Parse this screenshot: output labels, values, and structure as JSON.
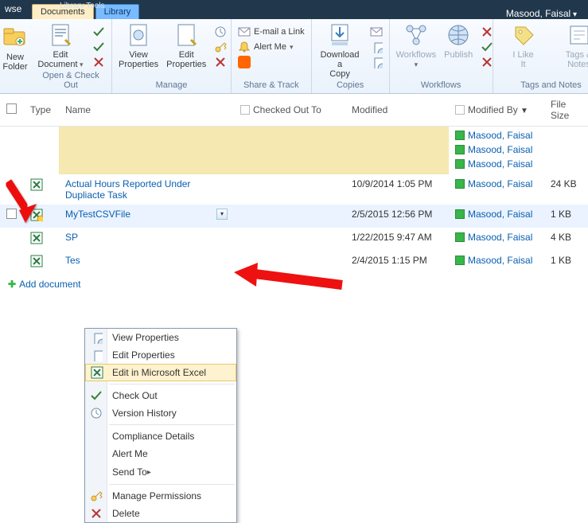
{
  "user": "Masood, Faisal",
  "tabset_label": "Library Tools",
  "tabs": {
    "browse_edge": "wse",
    "documents": "Documents",
    "library": "Library"
  },
  "ribbon": {
    "groups": {
      "open_checkout": {
        "title": "Open & Check Out",
        "new_folder": "New\nFolder",
        "edit_document": "Edit\nDocument",
        "check_out": "Check Out",
        "check_in": "Check In",
        "discard": "Discard Check Out"
      },
      "manage": {
        "title": "Manage",
        "view_properties": "View\nProperties",
        "edit_properties": "Edit\nProperties",
        "version": "Version History",
        "perms": "Document Permissions",
        "delete": "Delete Document"
      },
      "share_track": {
        "title": "Share & Track",
        "email": "E-mail a Link",
        "alert": "Alert Me",
        "rss": "RSS Feed"
      },
      "copies": {
        "title": "Copies",
        "download": "Download a\nCopy",
        "send_to": "Send To",
        "manage_copies": "Manage Copies",
        "source": "Go To Source"
      },
      "workflows": {
        "title": "Workflows",
        "workflows": "Workflows",
        "publish": "Publish",
        "unpublish": "Unpublish",
        "approve": "Approve/Reject",
        "cancel": "Cancel Approval"
      },
      "tags": {
        "title": "Tags and Notes",
        "like": "I Like\nIt",
        "tags": "Tags &\nNotes"
      }
    }
  },
  "columns": {
    "type": "Type",
    "name": "Name",
    "checked_out": "Checked Out To",
    "modified": "Modified",
    "modified_by": "Modified By",
    "size": "File Size"
  },
  "rows": [
    {
      "name": "Actual Hours Reported Under Dupliacte Task",
      "modified": "10/9/2014 1:05 PM",
      "by": "Masood, Faisal",
      "size": "24 KB"
    },
    {
      "name": "MyTestCSVFile",
      "modified": "2/5/2015 12:56 PM",
      "by": "Masood, Faisal",
      "size": "1 KB"
    },
    {
      "name": "SP",
      "modified": "1/22/2015 9:47 AM",
      "by": "Masood, Faisal",
      "size": "4 KB"
    },
    {
      "name": "Tes",
      "modified": "2/4/2015 1:15 PM",
      "by": "Masood, Faisal",
      "size": "1 KB"
    }
  ],
  "stacked_users": [
    "Masood, Faisal",
    "Masood, Faisal",
    "Masood, Faisal"
  ],
  "add_document": "Add document",
  "context_menu": {
    "view_properties": "View Properties",
    "edit_properties": "Edit Properties",
    "edit_excel": "Edit in Microsoft Excel",
    "check_out": "Check Out",
    "version_history": "Version History",
    "compliance": "Compliance Details",
    "alert_me": "Alert Me",
    "send_to": "Send To",
    "manage_permissions": "Manage Permissions",
    "delete": "Delete"
  }
}
